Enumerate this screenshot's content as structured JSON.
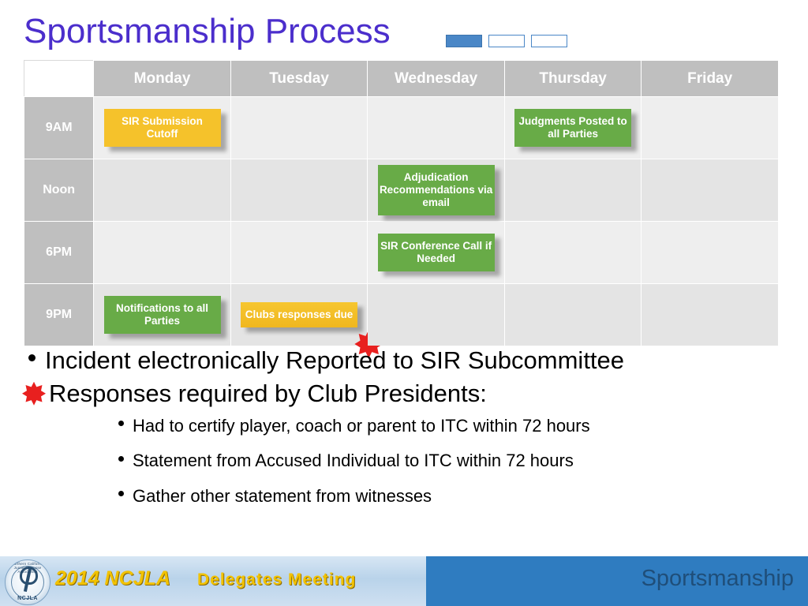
{
  "slide": {
    "title": "Sportsmanship Process"
  },
  "calendar": {
    "corner_label": "",
    "day_headers": [
      "Monday",
      "Tuesday",
      "Wednesday",
      "Thursday",
      "Friday"
    ],
    "rows": [
      {
        "time": "9AM",
        "cells": [
          {
            "text": "SIR Submission Cutoff",
            "color": "yellow",
            "star": false
          },
          {
            "text": "",
            "color": "",
            "star": false
          },
          {
            "text": "",
            "color": "",
            "star": false
          },
          {
            "text": "Judgments Posted to all Parties",
            "color": "green",
            "star": false
          },
          {
            "text": "",
            "color": "",
            "star": false
          }
        ]
      },
      {
        "time": "Noon",
        "cells": [
          {
            "text": "",
            "color": "",
            "star": false
          },
          {
            "text": "",
            "color": "",
            "star": false
          },
          {
            "text": "Adjudication Recommendations via email",
            "color": "green",
            "star": false
          },
          {
            "text": "",
            "color": "",
            "star": false
          },
          {
            "text": "",
            "color": "",
            "star": false
          }
        ]
      },
      {
        "time": "6PM",
        "cells": [
          {
            "text": "",
            "color": "",
            "star": false
          },
          {
            "text": "",
            "color": "",
            "star": false
          },
          {
            "text": "SIR Conference Call if Needed",
            "color": "green",
            "star": false
          },
          {
            "text": "",
            "color": "",
            "star": false
          },
          {
            "text": "",
            "color": "",
            "star": false
          }
        ]
      },
      {
        "time": "9PM",
        "cells": [
          {
            "text": "Notifications to all Parties",
            "color": "green",
            "star": false
          },
          {
            "text": "Clubs responses due",
            "color": "yellow",
            "star": true
          },
          {
            "text": "",
            "color": "",
            "star": false
          },
          {
            "text": "",
            "color": "",
            "star": false
          },
          {
            "text": "",
            "color": "",
            "star": false
          }
        ]
      }
    ]
  },
  "bullets": {
    "level1_a": "Incident electronically Reported to SIR Subcommittee",
    "level1_b": "Responses required by Club Presidents:",
    "level2": [
      "Had to certify player, coach or parent to ITC within 72 hours",
      "Statement from Accused Individual to ITC within 72 hours",
      "Gather other statement from witnesses"
    ]
  },
  "footer": {
    "year": "2014 NCJLA",
    "meeting": "Delegates Meeting",
    "right_label": "Sportsmanship",
    "logo_arc": "Northern California Junior Lacrosse Association",
    "logo_text": "NCJLA"
  },
  "colors": {
    "title": "#4b2ecc",
    "green": "#68ab47",
    "yellow": "#f5c22b",
    "red": "#e8201f",
    "header_gray": "#bfbfbf",
    "footer_blue": "#2f7cc0"
  }
}
